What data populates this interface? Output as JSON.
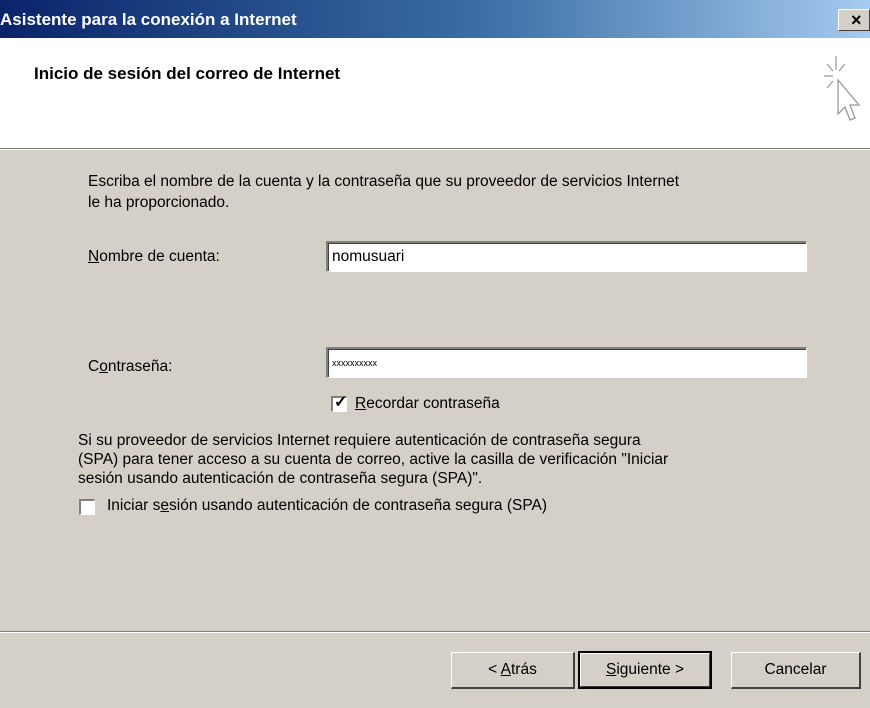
{
  "window": {
    "title": "Asistente para la conexión a Internet",
    "close_icon": "close-icon"
  },
  "header": {
    "title": "Inicio de sesión del correo de Internet",
    "icon": "wizard-cursor-sparkle-icon"
  },
  "body": {
    "intro_line1": "Escriba el nombre de la cuenta y la contraseña que su proveedor de servicios Internet",
    "intro_line2": "le ha proporcionado.",
    "account_label_key": "N",
    "account_label_rest": "ombre de cuenta:",
    "account_value": "nomusuari",
    "password_label_pre": "C",
    "password_label_key": "o",
    "password_label_rest": "ntraseña:",
    "password_value": "xxxxxxxxxx",
    "remember_checked": true,
    "remember_key": "R",
    "remember_rest": "ecordar contraseña",
    "spa_line1": "Si su proveedor de servicios Internet requiere autenticación de contraseña segura",
    "spa_line2": "(SPA) para tener acceso a su cuenta de correo, active la casilla de verificación \"Iniciar",
    "spa_line3": "sesión usando autenticación de contraseña segura (SPA)\".",
    "spa_checked": false,
    "spa_label_pre": "Iniciar s",
    "spa_label_key": "e",
    "spa_label_rest": "sión usando autenticación de contraseña segura (SPA)"
  },
  "buttons": {
    "back_pre": "< ",
    "back_key": "A",
    "back_rest": "trás",
    "next_key": "S",
    "next_rest": "iguiente >",
    "cancel": "Cancelar"
  }
}
